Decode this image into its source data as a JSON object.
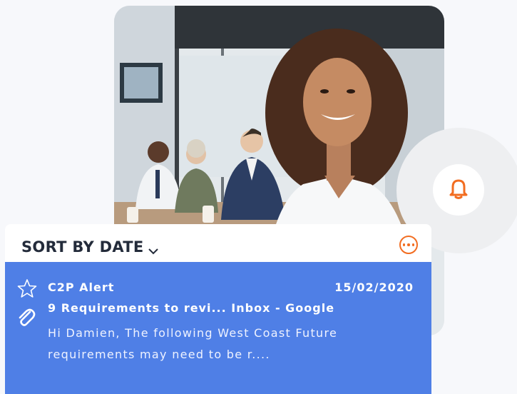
{
  "sort_bar": {
    "label": "SORT BY DATE"
  },
  "message": {
    "sender": "C2P Alert",
    "date": "15/02/2020",
    "subject": "9 Requirements to revi... Inbox - Google",
    "preview": "Hi Damien, The following West Coast Future requirements may need to be r...."
  },
  "icons": {
    "sort_chevron": "chevron-down-icon",
    "more": "more-options-icon",
    "bell": "bell-icon",
    "star": "star-icon",
    "attachment": "paperclip-icon"
  },
  "colors": {
    "accent_orange": "#f26d21",
    "card_blue": "#4f7fe6",
    "text_dark": "#232b3a"
  }
}
